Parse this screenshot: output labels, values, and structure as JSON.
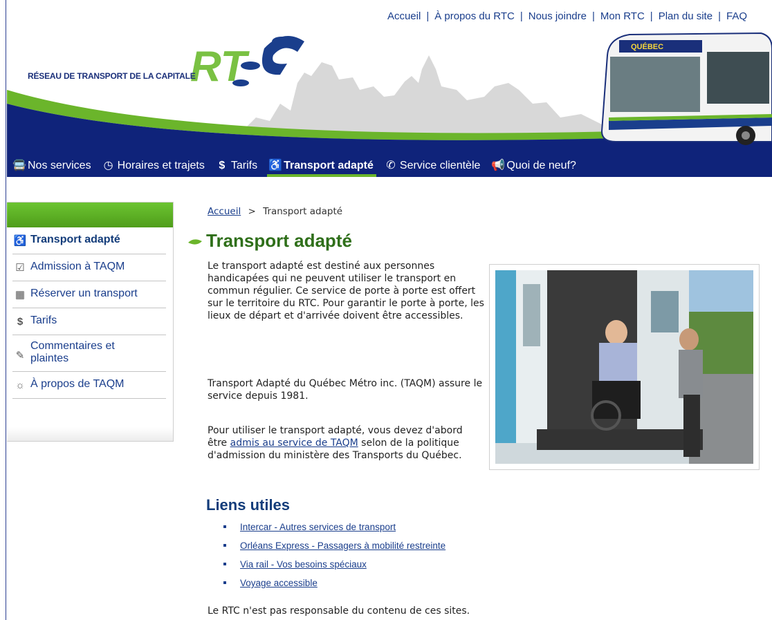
{
  "top_nav": {
    "items": [
      "Accueil",
      "À propos du RTC",
      "Nous joindre",
      "Mon RTC",
      "Plan du site",
      "FAQ"
    ]
  },
  "header": {
    "org_name": "RÉSEAU DE TRANSPORT DE LA CAPITALE",
    "logo_text": "RTC",
    "bus_sign": "QUÉBEC"
  },
  "main_nav": {
    "items": [
      {
        "label": "Nos services",
        "icon": "bus-icon"
      },
      {
        "label": "Horaires et trajets",
        "icon": "clock-icon"
      },
      {
        "label": "Tarifs",
        "icon": "dollar-icon"
      },
      {
        "label": "Transport adapté",
        "icon": "wheelchair-icon",
        "active": true
      },
      {
        "label": "Service clientèle",
        "icon": "phone-icon"
      },
      {
        "label": "Quoi de neuf?",
        "icon": "megaphone-icon"
      }
    ]
  },
  "sidebar": {
    "items": [
      {
        "label": "Transport adapté",
        "icon": "wheelchair-icon",
        "active": true
      },
      {
        "label": "Admission à TAQM",
        "icon": "checkbox-icon"
      },
      {
        "label": "Réserver un transport",
        "icon": "calendar-icon"
      },
      {
        "label": "Tarifs",
        "icon": "dollar-icon"
      },
      {
        "label": "Commentaires et plaintes",
        "icon": "pencil-icon"
      },
      {
        "label": "À propos de TAQM",
        "icon": "taqm-logo-icon"
      }
    ]
  },
  "breadcrumb": {
    "home": "Accueil",
    "separator": ">",
    "current": "Transport adapté"
  },
  "content": {
    "title": "Transport adapté",
    "para1": "Le transport adapté est destiné aux personnes handicapées qui ne peuvent utiliser le transport en commun régulier. Ce service de porte à porte est offert sur le territoire du RTC. Pour garantir le porte à porte, les lieux de départ et d'arrivée doivent être accessibles.",
    "para2": "Transport Adapté du Québec Métro inc. (TAQM) assure le service depuis 1981.",
    "para3_before": "Pour utiliser le transport adapté, vous devez d'abord être ",
    "para3_link": "admis au service de TAQM",
    "para3_after": " selon de la politique d'admission du ministère des Transports du Québec.",
    "links_title": "Liens utiles",
    "links": [
      "Intercar - Autres services de transport",
      "Orléans Express - Passagers à mobilité restreinte",
      "Via rail - Vos besoins spéciaux",
      "Voyage accessible"
    ],
    "disclaimer": "Le RTC n'est pas responsable du contenu de ces sites."
  },
  "colors": {
    "navy": "#0f237a",
    "green": "#6bb52b",
    "title_green": "#2f6f1a",
    "link_blue": "#1a3e8c"
  }
}
